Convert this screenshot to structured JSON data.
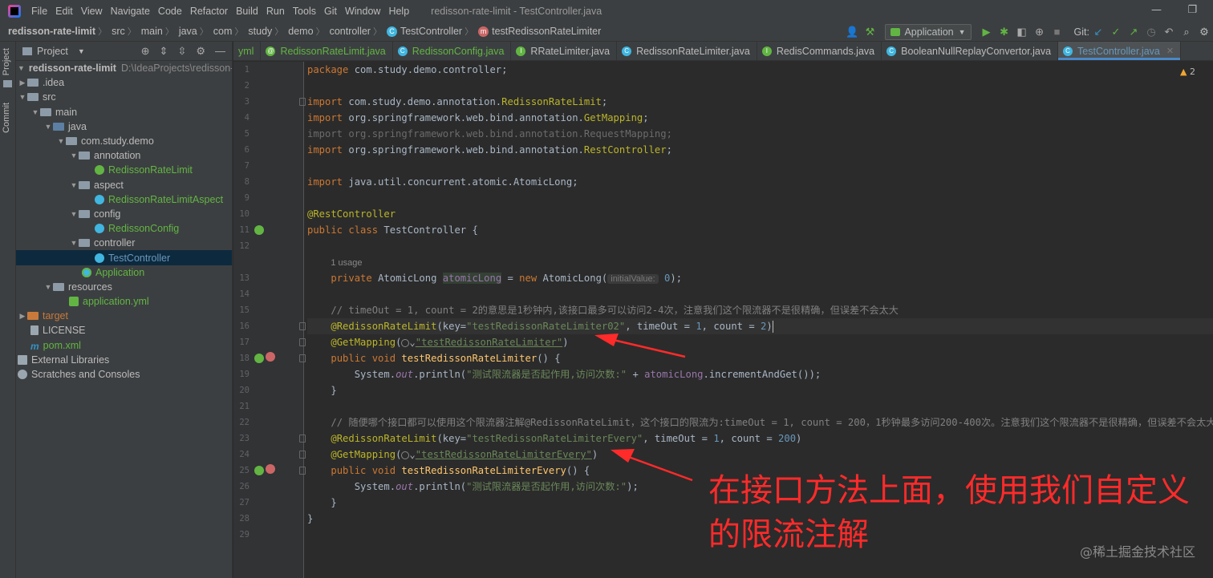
{
  "window": {
    "title": "redisson-rate-limit - TestController.java",
    "menu": [
      "File",
      "Edit",
      "View",
      "Navigate",
      "Code",
      "Refactor",
      "Build",
      "Run",
      "Tools",
      "Git",
      "Window",
      "Help"
    ]
  },
  "breadcrumb": [
    "redisson-rate-limit",
    "src",
    "main",
    "java",
    "com",
    "study",
    "demo",
    "controller",
    "TestController",
    "testRedissonRateLimiter"
  ],
  "toolbar": {
    "run_config": "Application",
    "git_label": "Git:"
  },
  "tool_strip": {
    "project_tab": "Project",
    "commit_tab": "Commit"
  },
  "project_panel": {
    "title": "Project",
    "root": {
      "name": "redisson-rate-limit",
      "path": "D:\\IdeaProjects\\redisson-rat"
    },
    "items": [
      {
        "label": ".idea"
      },
      {
        "label": "src"
      },
      {
        "label": "main"
      },
      {
        "label": "java"
      },
      {
        "label": "com.study.demo"
      },
      {
        "label": "annotation"
      },
      {
        "label": "RedissonRateLimit"
      },
      {
        "label": "aspect"
      },
      {
        "label": "RedissonRateLimitAspect"
      },
      {
        "label": "config"
      },
      {
        "label": "RedissonConfig"
      },
      {
        "label": "controller"
      },
      {
        "label": "TestController"
      },
      {
        "label": "Application"
      },
      {
        "label": "resources"
      },
      {
        "label": "application.yml"
      },
      {
        "label": "target"
      },
      {
        "label": "LICENSE"
      },
      {
        "label": "pom.xml"
      },
      {
        "label": "External Libraries"
      },
      {
        "label": "Scratches and Consoles"
      }
    ]
  },
  "tabs": [
    {
      "label": "yml"
    },
    {
      "label": "RedissonRateLimit.java"
    },
    {
      "label": "RedissonConfig.java"
    },
    {
      "label": "RRateLimiter.java"
    },
    {
      "label": "RedissonRateLimiter.java"
    },
    {
      "label": "RedisCommands.java"
    },
    {
      "label": "BooleanNullReplayConvertor.java"
    },
    {
      "label": "TestController.java"
    }
  ],
  "editor": {
    "warning_count": "2",
    "line_numbers": [
      "1",
      "2",
      "3",
      "4",
      "5",
      "6",
      "7",
      "8",
      "9",
      "10",
      "11",
      "12",
      "",
      "13",
      "14",
      "15",
      "16",
      "17",
      "18",
      "19",
      "20",
      "21",
      "22",
      "23",
      "24",
      "25",
      "26",
      "27",
      "28",
      "29"
    ],
    "code": {
      "l1_pkg": "com.study.demo.controller",
      "l3": "com.study.demo.annotation.",
      "l3b": "RedissonRateLimit",
      "l4": "org.springframework.web.bind.annotation.",
      "l4b": "GetMapping",
      "l5": "import org.springframework.web.bind.annotation.RequestMapping;",
      "l6": "org.springframework.web.bind.annotation.",
      "l6b": "RestController",
      "l8": "java.util.concurrent.atomic.AtomicLong",
      "l10": "@RestController",
      "l11_cls": "TestController {",
      "usage": "1 usage",
      "l13_type": "AtomicLong",
      "l13_var": "atomicLong",
      "l13_new": "AtomicLong(",
      "l13_hint": "initialValue:",
      "l13_num": "0",
      "l15_cmt": "// timeOut = 1, count = 2的意思是1秒钟内,该接口最多可以访问2-4次，注意我们这个限流器不是很精确，但误差不会太大",
      "l16_ann": "@RedissonRateLimit",
      "l16_key": "\"testRedissonRateLimiter02\"",
      "l16_n1": "1",
      "l16_n2": "2",
      "l17_ann": "@GetMapping",
      "l17_url": "\"testRedissonRateLimiter\"",
      "l18_m": "testRedissonRateLimiter",
      "l19_out": "out",
      "l19_str": "\"测试限流器是否起作用,访问次数:\"",
      "l19_var": "atomicLong",
      "l19_tail": ".incrementAndGet());",
      "l22_cmt": "// 随便哪个接口都可以使用这个限流器注解@RedissonRateLimit，这个接口的限流为:timeOut = 1, count = 200，1秒钟最多访问200-400次。注意我们这个限流器不是很精确，但误差不会太大",
      "l23_key": "\"testRedissonRateLimiterEvery\"",
      "l23_n1": "1",
      "l23_n2": "200",
      "l24_url": "\"testRedissonRateLimiterEvery\"",
      "l25_m": "testRedissonRateLimiterEvery",
      "l26_str": "\"测试限流器是否起作用,访问次数:\""
    }
  },
  "annotation": {
    "text": "在接口方法上面，使用我们自定义的限流注解"
  },
  "watermark": "@稀土掘金技术社区",
  "colors": {
    "editor_bg": "#2b2b2b",
    "panel_bg": "#3c3f41",
    "keyword": "#cc7832",
    "string": "#6a8759",
    "annotation": "#bbb529",
    "arrow_red": "#ff2a2a"
  }
}
